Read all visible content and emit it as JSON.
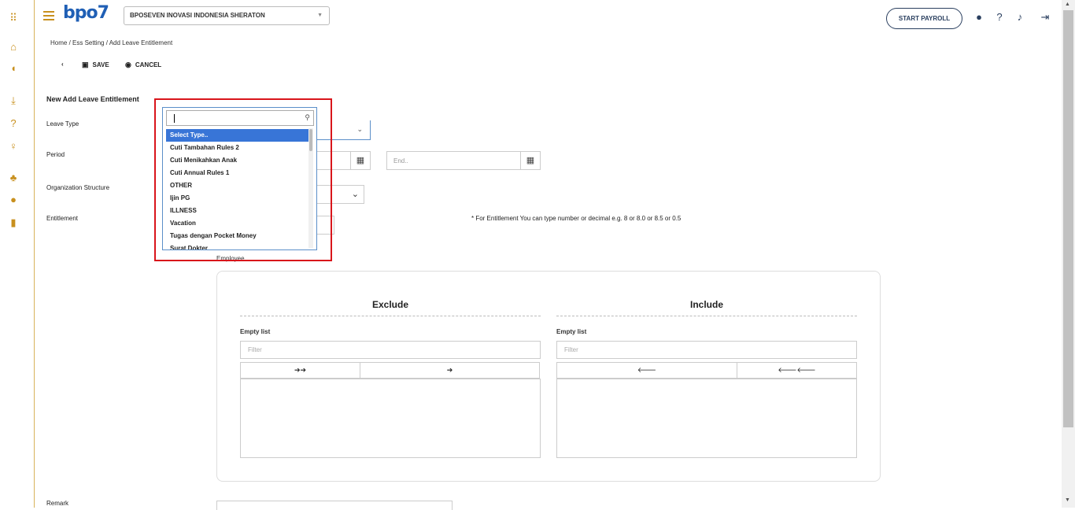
{
  "colors": {
    "accent": "#c8901e",
    "brand": "#1f5fb5",
    "navy": "#2a3f5f",
    "highlight": "#d9151b",
    "selected": "#3875d7"
  },
  "rail_icons": [
    "apps-grid-icon",
    "home-icon",
    "shield-icon",
    "download-icon",
    "help-icon",
    "lightbulb-icon",
    "android-icon",
    "apple-icon",
    "document-icon"
  ],
  "header": {
    "logo_text": "bpo7",
    "company": "BPOSEVEN INOVASI INDONESIA SHERATON",
    "start_payroll": "START PAYROLL",
    "icons": [
      "user-icon",
      "help-icon",
      "bell-icon",
      "logout-icon"
    ]
  },
  "breadcrumb": "Home / Ess Setting / Add Leave Entitlement",
  "toolbar": {
    "save": "SAVE",
    "cancel": "CANCEL"
  },
  "form": {
    "title": "New Add Leave Entitlement",
    "leave_type_label": "Leave Type",
    "period_label": "Period",
    "end_placeholder": "End..",
    "org_label": "Organization Structure",
    "entitlement_label": "Entitlement",
    "entitlement_note": "* For Entitlement You can type number or decimal e.g. 8 or 8.0 or 8.5 or 0.5",
    "employee_label": "Employee",
    "remark_label": "Remark"
  },
  "dual_list": {
    "exclude": {
      "title": "Exclude",
      "empty": "Empty list",
      "filter_placeholder": "Filter",
      "btn_all": "➔➔",
      "btn_one": "➔"
    },
    "include": {
      "title": "Include",
      "empty": "Empty list",
      "filter_placeholder": "Filter",
      "btn_one": "🡐",
      "btn_all": "🡐🡐"
    }
  },
  "dropdown": {
    "search_value": "",
    "options": [
      "Select Type..",
      "Cuti Tambahan Rules 2",
      "Cuti Menikahkan Anak",
      "Cuti Annual Rules 1",
      "OTHER",
      "Ijin PG",
      "ILLNESS",
      "Vacation",
      "Tugas dengan Pocket Money",
      "Surat Dokter"
    ],
    "selected_index": 0
  }
}
